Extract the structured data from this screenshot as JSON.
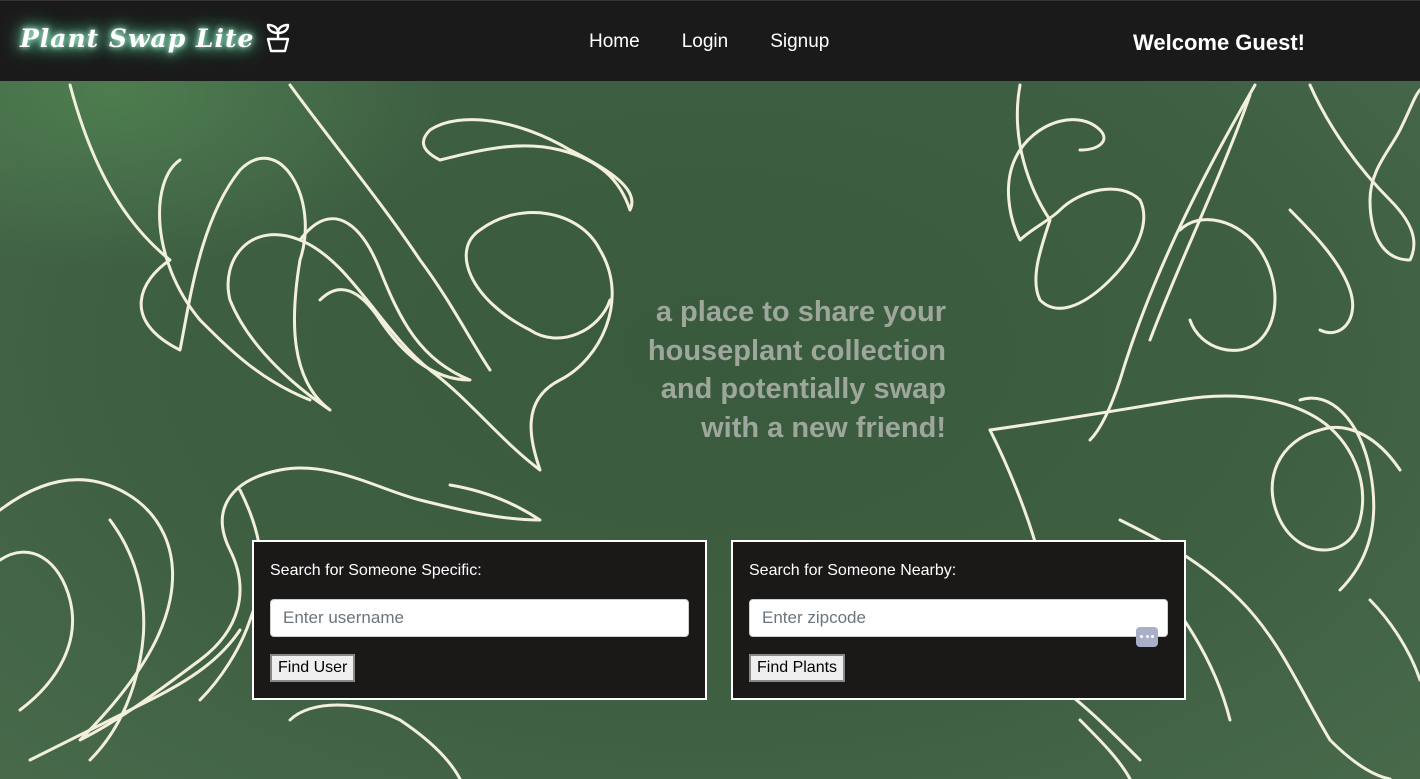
{
  "brand": {
    "name": "Plant Swap Lite",
    "icon": "sprout-pot-icon"
  },
  "nav": {
    "links": [
      {
        "label": "Home"
      },
      {
        "label": "Login"
      },
      {
        "label": "Signup"
      }
    ]
  },
  "welcome": "Welcome Guest!",
  "tagline": [
    "a place to share your",
    "houseplant collection",
    "and potentially swap",
    "with a new friend!"
  ],
  "search_user": {
    "label": "Search for Someone Specific:",
    "placeholder": "Enter username",
    "button": "Find User"
  },
  "search_nearby": {
    "label": "Search for Someone Nearby:",
    "placeholder": "Enter zipcode",
    "button": "Find Plants",
    "icon": "keypad-icon"
  },
  "colors": {
    "navbar": "#1b1a1a",
    "background": "#3e5e42",
    "tagline": "#9ea79c",
    "card": "#1b1818",
    "line_art": "#f2f0dc"
  }
}
